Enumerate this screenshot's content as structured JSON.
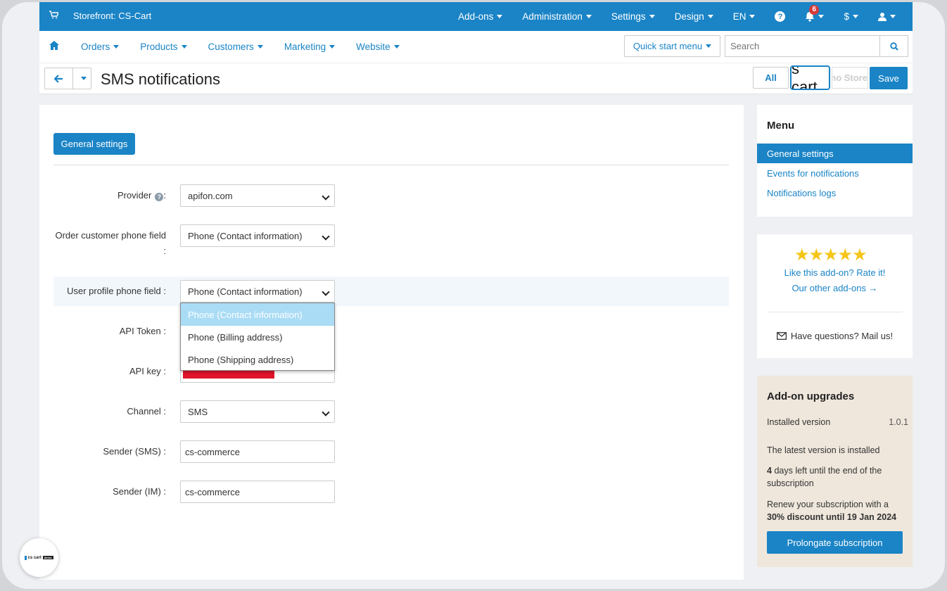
{
  "topbar": {
    "store": "Storefront: CS-Cart",
    "items": [
      "Add-ons",
      "Administration",
      "Settings",
      "Design",
      "EN"
    ],
    "notifications": "6",
    "currency": "$"
  },
  "subnav": {
    "items": [
      "Orders",
      "Products",
      "Customers",
      "Marketing",
      "Website"
    ],
    "quick_start": "Quick start menu",
    "search_placeholder": "Search"
  },
  "titlebar": {
    "title": "SMS notifications",
    "all": "All",
    "cart_logo": "s cart",
    "demo": "Demo Store",
    "save": "Save"
  },
  "main": {
    "tab": "General settings",
    "fields": {
      "provider": {
        "label": "Provider",
        "value": "apifon.com"
      },
      "order_phone": {
        "label": "Order customer phone field",
        "colon": ":",
        "value": "Phone (Contact information)"
      },
      "user_phone": {
        "label": "User profile phone field :",
        "value": "Phone (Contact information)"
      },
      "api_token": {
        "label": "API Token :"
      },
      "api_key": {
        "label": "API key :"
      },
      "channel": {
        "label": "Channel :",
        "value": "SMS"
      },
      "sender_sms": {
        "label": "Sender (SMS) :",
        "value": "cs-commerce"
      },
      "sender_im": {
        "label": "Sender (IM) :",
        "value": "cs-commerce"
      }
    },
    "dropdown_options": [
      "Phone (Contact information)",
      "Phone (Billing address)",
      "Phone (Shipping address)"
    ],
    "colon": ":"
  },
  "sidebar": {
    "menu_title": "Menu",
    "menu_items": [
      "General settings",
      "Events for notifications",
      "Notifications logs"
    ],
    "rate": {
      "stars": "★★★★★",
      "rating": 5,
      "like": "Like this add-on? Rate it!",
      "other": "Our other add-ons →",
      "mail": "Have questions? Mail us!"
    },
    "upgrades": {
      "title": "Add-on upgrades",
      "installed_label": "Installed version",
      "installed_value": "1.0.1",
      "latest": "The latest version is installed",
      "days_num": "4",
      "days_text": "days left until the end of the subscription",
      "renew_text": "Renew your subscription with a",
      "renew_bold": "30% discount until 19 Jan 2024",
      "button": "Prolongate subscription"
    }
  },
  "bubble": {
    "logo": "cs cart",
    "tag": "demo"
  },
  "colors": {
    "accent": "#1a84c6",
    "highlight_option": "#aadcf5",
    "stars": "#f5c518",
    "upgrade_bg": "#efe7dc",
    "redbar": "#e0152a"
  }
}
